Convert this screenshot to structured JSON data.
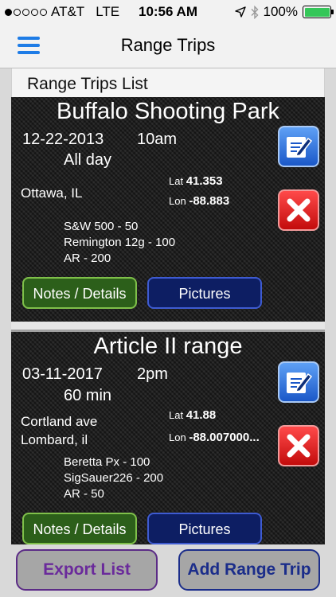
{
  "status_bar": {
    "carrier": "AT&T",
    "network": "LTE",
    "time": "10:56 AM",
    "battery": "100%",
    "battery_level": 1.0,
    "signal_bars": 1,
    "icons": [
      "location-arrow-icon",
      "bluetooth-icon",
      "battery-icon"
    ]
  },
  "nav": {
    "title": "Range Trips",
    "menu_icon": "hamburger-menu-icon"
  },
  "list": {
    "header": "Range Trips List"
  },
  "trips": [
    {
      "name": "Buffalo Shooting Park",
      "date": "12-22-2013",
      "time": "10am",
      "duration": "All day",
      "location_line1": "Ottawa, IL",
      "location_line2": "",
      "lat_label": "Lat",
      "lat": "41.353",
      "lon_label": "Lon",
      "lon": "-88.883",
      "ammo": [
        "S&W 500  - 50",
        "Remington 12g - 100",
        "AR - 200"
      ],
      "notes_label": "Notes / Details",
      "pictures_label": "Pictures"
    },
    {
      "name": "Article II range",
      "date": "03-11-2017",
      "time": "2pm",
      "duration": "60 min",
      "location_line1": "Cortland ave",
      "location_line2": "Lombard, il",
      "lat_label": "Lat",
      "lat": "41.88",
      "lon_label": "Lon",
      "lon": "-88.007000...",
      "ammo": [
        "Beretta Px - 100",
        "SigSauer226 - 200",
        "AR - 50"
      ],
      "notes_label": "Notes / Details",
      "pictures_label": "Pictures"
    }
  ],
  "bottom": {
    "export_label": "Export List",
    "add_label": "Add Range Trip"
  },
  "colors": {
    "accent_blue": "#1e7ce6",
    "notes_green": "#2c5f1a",
    "pictures_navy": "#0d1e63",
    "delete_red": "#e01414",
    "edit_blue": "#2f74dd",
    "export_purple": "#6a2a9b"
  }
}
